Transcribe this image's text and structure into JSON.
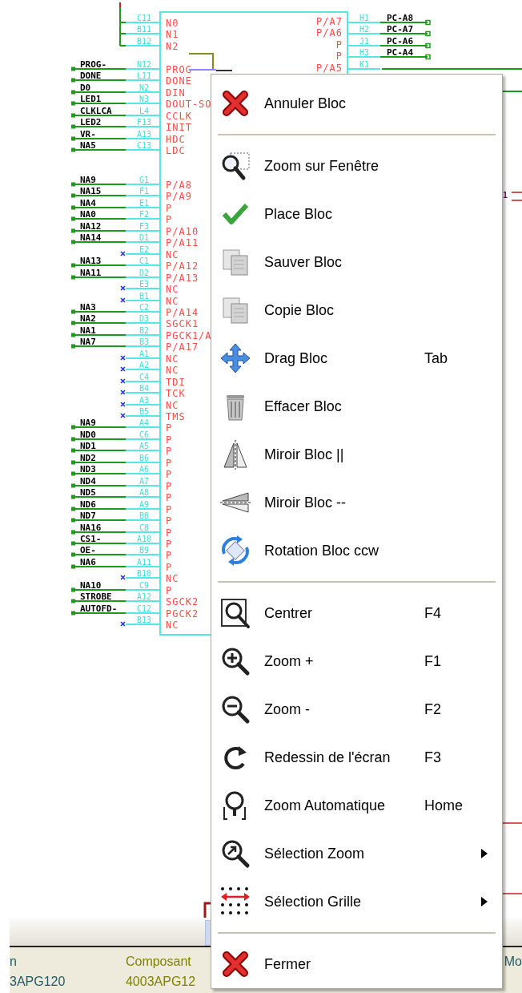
{
  "schematic": {
    "left_pin_groups": [
      {
        "pins": [
          {
            "kind": "bus",
            "pin": "C11",
            "name": "N0"
          },
          {
            "kind": "bus",
            "pin": "B11",
            "name": "N1"
          },
          {
            "kind": "bus",
            "pin": "B12",
            "name": "N2"
          }
        ]
      },
      {
        "pins": [
          {
            "kind": "net",
            "net": "PROG-",
            "pin": "N12",
            "name": "PROG"
          },
          {
            "kind": "net",
            "net": "DONE",
            "pin": "L11",
            "name": "DONE"
          },
          {
            "kind": "net",
            "net": "D0",
            "pin": "N2",
            "name": "DIN"
          },
          {
            "kind": "net",
            "net": "LED1",
            "pin": "N3",
            "name": "DOUT-SO"
          },
          {
            "kind": "net",
            "net": "CLKLCA",
            "pin": "L4",
            "name": "CCLK"
          },
          {
            "kind": "net",
            "net": "LED2",
            "pin": "F13",
            "name": "INIT"
          },
          {
            "kind": "net",
            "net": "VR-",
            "pin": "A13",
            "name": "HDC"
          },
          {
            "kind": "net",
            "net": "NA5",
            "pin": "C13",
            "name": "LDC"
          }
        ]
      },
      {
        "pins": [
          {
            "kind": "net",
            "net": "NA9",
            "pin": "G1",
            "name": "P/A8"
          },
          {
            "kind": "net",
            "net": "NA15",
            "pin": "F1",
            "name": "P/A9"
          },
          {
            "kind": "net",
            "net": "NA4",
            "pin": "E1",
            "name": "P"
          },
          {
            "kind": "net",
            "net": "NA0",
            "pin": "F2",
            "name": "P"
          },
          {
            "kind": "net",
            "net": "NA12",
            "pin": "F3",
            "name": "P/A10"
          },
          {
            "kind": "net",
            "net": "NA14",
            "pin": "D1",
            "name": "P/A11"
          },
          {
            "kind": "nc",
            "pin": "E2",
            "name": "NC"
          },
          {
            "kind": "net",
            "net": "NA13",
            "pin": "C1",
            "name": "P/A12"
          },
          {
            "kind": "net",
            "net": "NA11",
            "pin": "D2",
            "name": "P/A13"
          },
          {
            "kind": "nc",
            "pin": "E3",
            "name": "NC"
          },
          {
            "kind": "nc",
            "pin": "B1",
            "name": "NC"
          },
          {
            "kind": "net",
            "net": "NA3",
            "pin": "C2",
            "name": "P/A14"
          },
          {
            "kind": "net",
            "net": "NA2",
            "pin": "D3",
            "name": "SGCK1"
          },
          {
            "kind": "net",
            "net": "NA1",
            "pin": "B2",
            "name": "PGCK1/A"
          },
          {
            "kind": "net",
            "net": "NA7",
            "pin": "B3",
            "name": "P/A17"
          },
          {
            "kind": "nc",
            "pin": "A1",
            "name": "NC"
          },
          {
            "kind": "nc",
            "pin": "A2",
            "name": "NC"
          },
          {
            "kind": "nc",
            "pin": "C4",
            "name": "TDI"
          },
          {
            "kind": "nc",
            "pin": "B4",
            "name": "TCK"
          },
          {
            "kind": "nc",
            "pin": "A3",
            "name": "NC"
          },
          {
            "kind": "nc",
            "pin": "B5",
            "name": "TMS"
          },
          {
            "kind": "net",
            "net": "NA9",
            "pin": "A4",
            "name": "P"
          },
          {
            "kind": "net",
            "net": "ND0",
            "pin": "C6",
            "name": "P"
          },
          {
            "kind": "net",
            "net": "ND1",
            "pin": "A5",
            "name": "P"
          },
          {
            "kind": "net",
            "net": "ND2",
            "pin": "B6",
            "name": "P"
          },
          {
            "kind": "net",
            "net": "ND3",
            "pin": "A6",
            "name": "P"
          },
          {
            "kind": "net",
            "net": "ND4",
            "pin": "A7",
            "name": "P"
          },
          {
            "kind": "net",
            "net": "ND5",
            "pin": "A8",
            "name": "P"
          },
          {
            "kind": "net",
            "net": "ND6",
            "pin": "A9",
            "name": "P"
          },
          {
            "kind": "net",
            "net": "ND7",
            "pin": "B8",
            "name": "P"
          },
          {
            "kind": "net",
            "net": "NA16",
            "pin": "C8",
            "name": "P"
          },
          {
            "kind": "net",
            "net": "CS1-",
            "pin": "A10",
            "name": "P"
          },
          {
            "kind": "net",
            "net": "OE-",
            "pin": "B9",
            "name": "P"
          },
          {
            "kind": "net",
            "net": "NA6",
            "pin": "A11",
            "name": "P"
          },
          {
            "kind": "nc",
            "pin": "B10",
            "name": "NC"
          },
          {
            "kind": "net",
            "net": "NA10",
            "pin": "C9",
            "name": "P"
          },
          {
            "kind": "net",
            "net": "STROBE",
            "pin": "A12",
            "name": "SGCK2"
          },
          {
            "kind": "net",
            "net": "AUTOFD-",
            "pin": "C12",
            "name": "PGCK2"
          },
          {
            "kind": "nc",
            "pin": "B13",
            "name": "NC"
          }
        ]
      }
    ],
    "right_pins": [
      {
        "pin": "H1",
        "name": "P/A7",
        "net": "PC-A8"
      },
      {
        "pin": "H2",
        "name": "P/A6",
        "net": "PC-A7"
      },
      {
        "pin": "J1",
        "name": "P",
        "net": "PC-A6"
      },
      {
        "pin": "H3",
        "name": "P",
        "net": "PC-A4"
      },
      {
        "pin": "K1",
        "name": "P/A5"
      }
    ],
    "stray_label": "1"
  },
  "context_menu": {
    "items": [
      {
        "kind": "item",
        "label": "Annuler Bloc",
        "submenu": false
      },
      {
        "kind": "separator"
      },
      {
        "kind": "item",
        "label": "Zoom sur Fenêtre",
        "submenu": false
      },
      {
        "kind": "item",
        "label": "Place Bloc",
        "submenu": false
      },
      {
        "kind": "item",
        "label": "Sauver Bloc",
        "submenu": false
      },
      {
        "kind": "item",
        "label": "Copie Bloc",
        "submenu": false
      },
      {
        "kind": "item",
        "label": "Drag Bloc",
        "shortcut": "Tab",
        "submenu": false
      },
      {
        "kind": "item",
        "label": "Effacer Bloc",
        "submenu": false
      },
      {
        "kind": "item",
        "label": "Miroir Bloc ||",
        "submenu": false
      },
      {
        "kind": "item",
        "label": "Miroir Bloc --",
        "submenu": false
      },
      {
        "kind": "item",
        "label": "Rotation Bloc ccw",
        "submenu": false
      },
      {
        "kind": "separator"
      },
      {
        "kind": "item",
        "label": "Centrer",
        "shortcut": "F4",
        "submenu": false
      },
      {
        "kind": "item",
        "label": "Zoom +",
        "shortcut": "F1",
        "submenu": false
      },
      {
        "kind": "item",
        "label": "Zoom -",
        "shortcut": "F2",
        "submenu": false
      },
      {
        "kind": "item",
        "label": "Redessin de l'écran",
        "shortcut": "F3",
        "submenu": false
      },
      {
        "kind": "item",
        "label": "Zoom Automatique",
        "shortcut": "Home",
        "submenu": false
      },
      {
        "kind": "item",
        "label": "Sélection Zoom",
        "submenu": true
      },
      {
        "kind": "item",
        "label": "Sélection Grille",
        "submenu": true
      },
      {
        "kind": "separator"
      },
      {
        "kind": "item",
        "label": "Fermer",
        "submenu": false
      }
    ]
  },
  "status_bar": {
    "fields": [
      {
        "title": "n",
        "value": "3APG120",
        "color": "#1f5a66"
      },
      {
        "title": "Composant",
        "value": "4003APG12",
        "color": "#808000"
      },
      {
        "title": "Mo",
        "color": "#1f5a66"
      }
    ]
  }
}
